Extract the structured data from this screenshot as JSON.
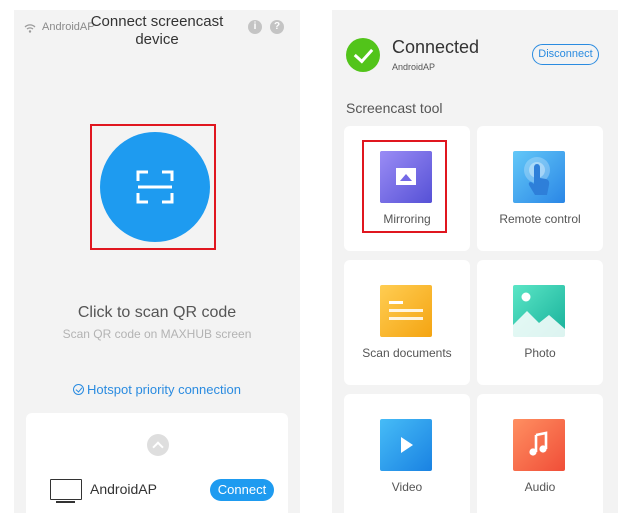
{
  "left": {
    "network_name": "AndroidAP",
    "title": "Connect screencast device",
    "info_glyph": "i",
    "help_glyph": "?",
    "scan_title": "Click to scan QR code",
    "scan_subtitle": "Scan QR code on MAXHUB screen",
    "hotspot_link": "Hotspot priority connection",
    "device": {
      "name": "AndroidAP",
      "connect_label": "Connect"
    }
  },
  "right": {
    "status_title": "Connected",
    "status_network": "AndroidAP",
    "disconnect_label": "Disconnect",
    "section_title": "Screencast tool",
    "tools": [
      {
        "label": "Mirroring",
        "icon": "mirroring-icon"
      },
      {
        "label": "Remote control",
        "icon": "remote-control-icon"
      },
      {
        "label": "Scan documents",
        "icon": "scan-documents-icon"
      },
      {
        "label": "Photo",
        "icon": "photo-icon"
      },
      {
        "label": "Video",
        "icon": "video-icon"
      },
      {
        "label": "Audio",
        "icon": "audio-icon"
      }
    ]
  },
  "colors": {
    "accent_blue": "#1e9bf0",
    "connected_green": "#52c41a",
    "highlight_red": "#e0161f",
    "background": "#f3f3f3"
  }
}
